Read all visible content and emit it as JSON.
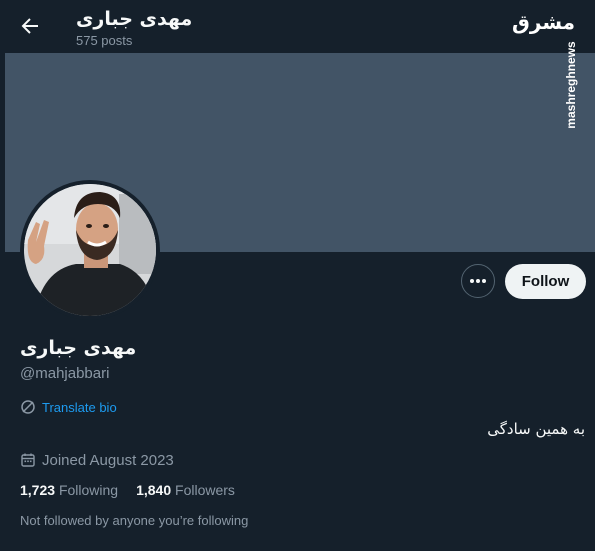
{
  "header": {
    "name": "مهدی جباری",
    "posts": "575 posts",
    "back_icon": "arrow-left-icon"
  },
  "watermark": {
    "logo_text": "مشرق",
    "site": "mashreghnews"
  },
  "profile": {
    "name": "مهدی جباری",
    "handle": "@mahjabbari",
    "translate_label": "Translate bio",
    "bio": "به همین سادگی",
    "joined": "Joined August 2023",
    "following_count": "1,723",
    "following_label": "Following",
    "followers_count": "1,840",
    "followers_label": "Followers",
    "not_followed": "Not followed by anyone you’re following"
  },
  "actions": {
    "follow_label": "Follow",
    "more_icon": "more-icon"
  },
  "colors": {
    "background": "#15202b",
    "banner": "#425466",
    "accent": "#1d9bf0",
    "muted": "#8b98a5",
    "button": "#eff3f4"
  }
}
